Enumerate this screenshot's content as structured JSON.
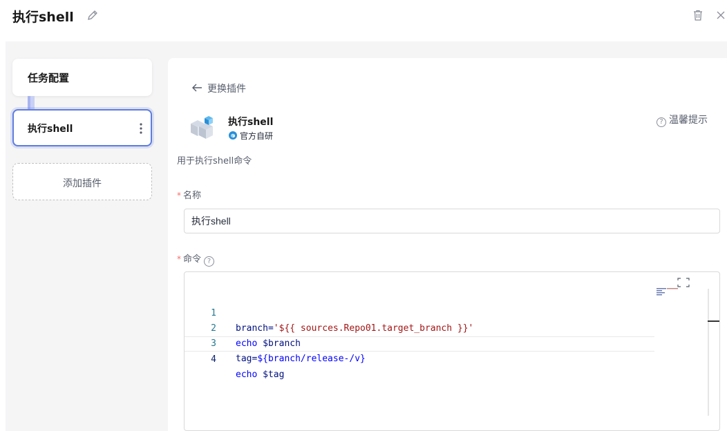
{
  "header": {
    "title": "执行shell"
  },
  "stages": {
    "task_config": "任务配置",
    "shell_step": "执行shell",
    "add_plugin": "添加插件"
  },
  "panel": {
    "back_label": "更换插件",
    "plugin_name": "执行shell",
    "official_badge": "官方自研",
    "tip_label": "温馨提示",
    "description": "用于执行shell命令",
    "name_label": "名称",
    "name_value": "执行shell",
    "command_label": "命令",
    "required_mark": "*"
  },
  "editor": {
    "lines": [
      {
        "num": "1",
        "text": "branch='${{ sources.Repo01.target_branch }}'"
      },
      {
        "num": "2",
        "text": "echo $branch"
      },
      {
        "num": "3",
        "text": "tag=${branch/release-/v}"
      },
      {
        "num": "4",
        "text": "echo $tag"
      }
    ],
    "line1": {
      "a": "branch=",
      "b": "'${{ sources.Repo01.target_branch }}'"
    },
    "line2": {
      "a": "echo",
      "b": " $branch"
    },
    "line3": {
      "a": "tag=",
      "b": "${branch/release-/v}"
    },
    "line4": {
      "a": "echo",
      "b": " $tag"
    }
  },
  "colors": {
    "accent": "#5e7ce0",
    "required": "#f66f6a",
    "keyword": "#0000ff",
    "string": "#a31515"
  },
  "icons": [
    "edit-icon",
    "trash-icon",
    "close-icon",
    "more-icon",
    "back-arrow-icon",
    "plugin-logo-icon",
    "official-icon",
    "help-icon",
    "expand-icon"
  ]
}
